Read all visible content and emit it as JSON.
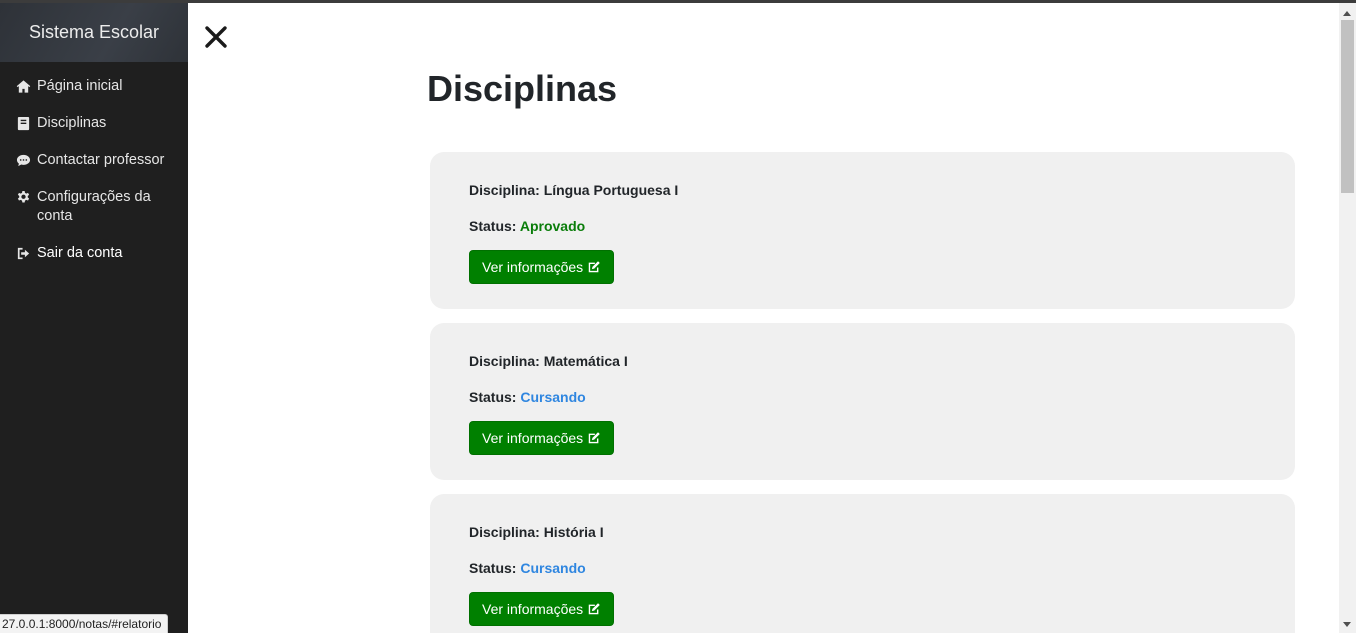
{
  "app": {
    "title": "Sistema Escolar"
  },
  "sidebar": {
    "items": [
      {
        "label": "Página inicial",
        "icon": "home-icon"
      },
      {
        "label": "Disciplinas",
        "icon": "book-icon"
      },
      {
        "label": "Contactar professor",
        "icon": "chat-icon"
      },
      {
        "label": "Configurações da conta",
        "icon": "gear-icon"
      },
      {
        "label": "Sair da conta",
        "icon": "sign-out-icon"
      }
    ]
  },
  "status_bar": {
    "url": "27.0.0.1:8000/notas/#relatorio"
  },
  "main": {
    "title": "Disciplinas",
    "subject_prefix": "Disciplina: ",
    "status_prefix": "Status: ",
    "button_label": "Ver informações",
    "disciplines": [
      {
        "name": "Língua Portuguesa I",
        "status": "Aprovado",
        "status_color": "#0a7d0a"
      },
      {
        "name": "Matemática I",
        "status": "Cursando",
        "status_color": "#2f86e0"
      },
      {
        "name": "História I",
        "status": "Cursando",
        "status_color": "#2f86e0"
      }
    ]
  },
  "colors": {
    "sidebar_bg": "#1f1f1f",
    "button_bg": "#008000",
    "card_bg": "#f0f0f0"
  }
}
